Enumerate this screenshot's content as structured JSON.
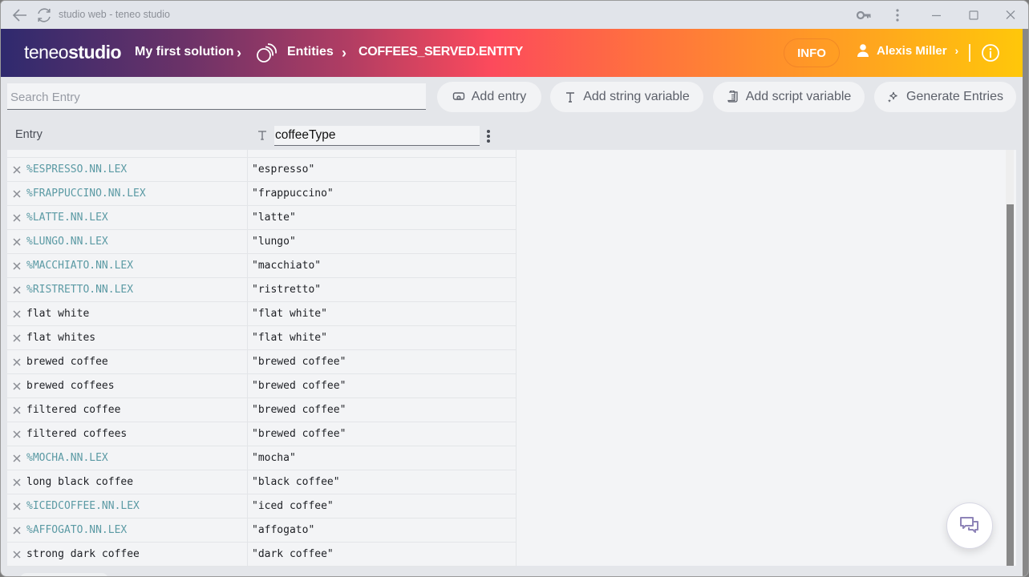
{
  "window": {
    "title": "studio web - teneo studio"
  },
  "header": {
    "logo_light": "teneo",
    "logo_bold": "studio",
    "breadcrumbs": [
      {
        "label": "My first solution"
      },
      {
        "label": "Entities",
        "icon": "entities-icon"
      },
      {
        "label": "COFFEES_SERVED.ENTITY"
      }
    ],
    "info_button": "INFO",
    "user_name": "Alexis Miller",
    "user_chevron": "›",
    "chevron": "›"
  },
  "toolbar": {
    "search_placeholder": "Search Entry",
    "search_value": "",
    "buttons": [
      {
        "label": "Add entry",
        "icon": "add-entry-icon"
      },
      {
        "label": "Add string variable",
        "icon": "text-type-icon"
      },
      {
        "label": "Add script variable",
        "icon": "script-icon"
      },
      {
        "label": "Generate Entries",
        "icon": "sparkle-icon"
      }
    ]
  },
  "table": {
    "entry_header": "Entry",
    "variable_name": "coffeeType",
    "variable_type_icon": "text-type-icon",
    "rows": [
      {
        "entry": "%ESPRESSO.NN.LEX",
        "value": "\"espresso\"",
        "is_lex": true
      },
      {
        "entry": "%FRAPPUCCINO.NN.LEX",
        "value": "\"frappuccino\"",
        "is_lex": true
      },
      {
        "entry": "%LATTE.NN.LEX",
        "value": "\"latte\"",
        "is_lex": true
      },
      {
        "entry": "%LUNGO.NN.LEX",
        "value": "\"lungo\"",
        "is_lex": true
      },
      {
        "entry": "%MACCHIATO.NN.LEX",
        "value": "\"macchiato\"",
        "is_lex": true
      },
      {
        "entry": "%RISTRETTO.NN.LEX",
        "value": "\"ristretto\"",
        "is_lex": true
      },
      {
        "entry": "flat white",
        "value": "\"flat white\"",
        "is_lex": false
      },
      {
        "entry": "flat whites",
        "value": "\"flat white\"",
        "is_lex": false
      },
      {
        "entry": "brewed coffee",
        "value": "\"brewed coffee\"",
        "is_lex": false
      },
      {
        "entry": "brewed coffees",
        "value": "\"brewed coffee\"",
        "is_lex": false
      },
      {
        "entry": "filtered coffee",
        "value": "\"brewed coffee\"",
        "is_lex": false
      },
      {
        "entry": "filtered coffees",
        "value": "\"brewed coffee\"",
        "is_lex": false
      },
      {
        "entry": "%MOCHA.NN.LEX",
        "value": "\"mocha\"",
        "is_lex": true
      },
      {
        "entry": "long black coffee",
        "value": "\"black coffee\"",
        "is_lex": false
      },
      {
        "entry": "%ICEDCOFFEE.NN.LEX",
        "value": "\"iced coffee\"",
        "is_lex": true
      },
      {
        "entry": "%AFFOGATO.NN.LEX",
        "value": "\"affogato\"",
        "is_lex": true
      },
      {
        "entry": "strong dark coffee",
        "value": "\"dark coffee\"",
        "is_lex": false
      }
    ]
  },
  "colors": {
    "lex_entry": "#5b9aa4",
    "header_gradient_start": "#2f2a6e",
    "header_gradient_mid": "#fc4a5c",
    "header_gradient_end": "#ffc70a",
    "chat_icon": "#8e84b8"
  }
}
